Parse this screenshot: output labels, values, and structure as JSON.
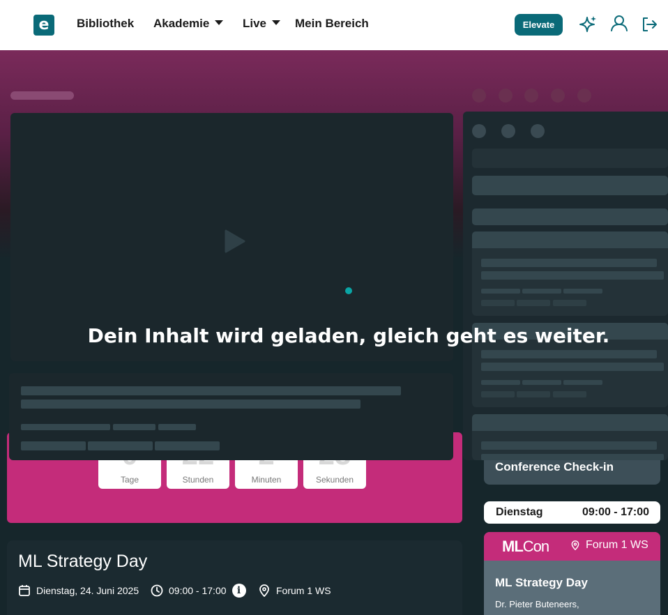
{
  "header": {
    "logo_letter": "e",
    "nav": [
      {
        "label": "Bibliothek",
        "has_dropdown": false
      },
      {
        "label": "Akademie",
        "has_dropdown": true
      },
      {
        "label": "Live",
        "has_dropdown": true
      },
      {
        "label": "Mein Bereich",
        "has_dropdown": false
      }
    ],
    "elevate_label": "Elevate",
    "icons": [
      "sparkle-icon",
      "user-icon",
      "logout-icon"
    ]
  },
  "loading": {
    "message": "Dein Inhalt wird geladen, gleich geht es weiter."
  },
  "countdown": {
    "units": [
      {
        "value": "0",
        "label": "Tage"
      },
      {
        "value": "22",
        "label": "Stunden"
      },
      {
        "value": "2",
        "label": "Minuten"
      },
      {
        "value": "23",
        "label": "Sekunden"
      }
    ]
  },
  "event": {
    "title": "ML Strategy Day",
    "date": "Dienstag, 24. Juni 2025",
    "time": "09:00 - 17:00",
    "location": "Forum 1 WS"
  },
  "sidebar": {
    "checkin_label": "Conference Check-in",
    "day": "Dienstag",
    "day_time": "09:00 - 17:00",
    "session": {
      "brand_ml": "ML",
      "brand_con": "Con",
      "location": "Forum 1 WS",
      "title": "ML Strategy Day",
      "speaker": "Dr. Pieter Buteneers,"
    }
  },
  "colors": {
    "brand_teal": "#0a6a78",
    "brand_pink": "#c42c7a",
    "dark_bg": "#16262b",
    "spinner": "#0aa5a5"
  }
}
